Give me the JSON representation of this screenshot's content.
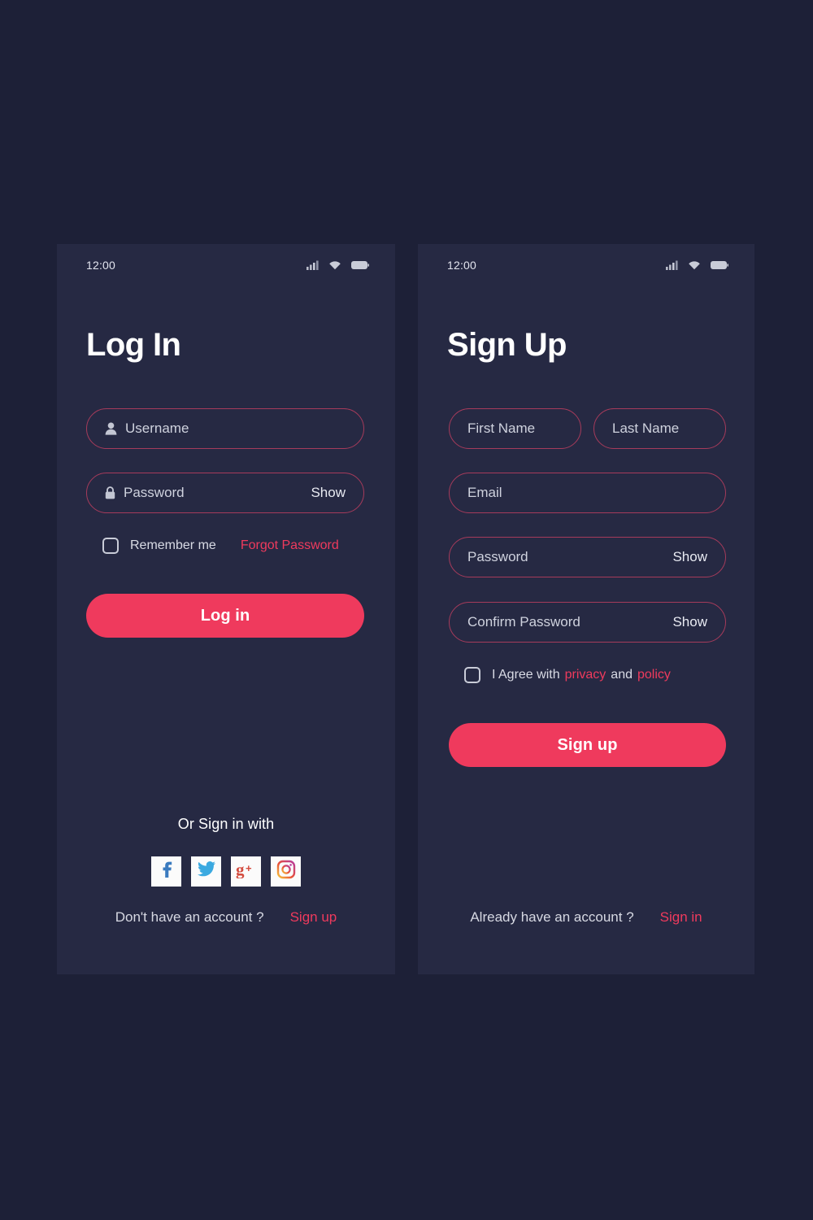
{
  "theme": {
    "page_bg": "#1d2037",
    "card_bg": "#262943",
    "accent": "#ef3a5d",
    "field_border": "#a63b5b",
    "text_primary": "#ffffff",
    "text_muted": "#cfd2de"
  },
  "login": {
    "status": {
      "time": "12:00",
      "icons": [
        "signal-icon",
        "wifi-icon",
        "battery-icon"
      ]
    },
    "title": "Log In",
    "fields": {
      "username": {
        "label": "Username",
        "icon": "user-icon"
      },
      "password": {
        "label": "Password",
        "icon": "lock-icon",
        "show": "Show"
      }
    },
    "remember_me": "Remember me",
    "forgot_password": "Forgot Password",
    "submit": "Log in",
    "or_text": "Or Sign in with",
    "social": [
      {
        "name": "facebook-icon",
        "label": "Facebook"
      },
      {
        "name": "twitter-icon",
        "label": "Twitter"
      },
      {
        "name": "google-plus-icon",
        "label": "Google Plus"
      },
      {
        "name": "instagram-icon",
        "label": "Instagram"
      }
    ],
    "footer_text": "Don't have an account ?",
    "footer_link": "Sign up"
  },
  "signup": {
    "status": {
      "time": "12:00",
      "icons": [
        "signal-icon",
        "wifi-icon",
        "battery-icon"
      ]
    },
    "title": "Sign Up",
    "fields": {
      "first_name": {
        "label": "First Name"
      },
      "last_name": {
        "label": "Last Name"
      },
      "email": {
        "label": "Email"
      },
      "password": {
        "label": "Password",
        "show": "Show"
      },
      "confirm_password": {
        "label": "Confirm Password",
        "show": "Show"
      }
    },
    "agree": {
      "prefix": "I Agree with",
      "privacy": "privacy",
      "conjunction": "and",
      "policy": "policy"
    },
    "submit": "Sign up",
    "footer_text": "Already have an account ?",
    "footer_link": "Sign in"
  }
}
